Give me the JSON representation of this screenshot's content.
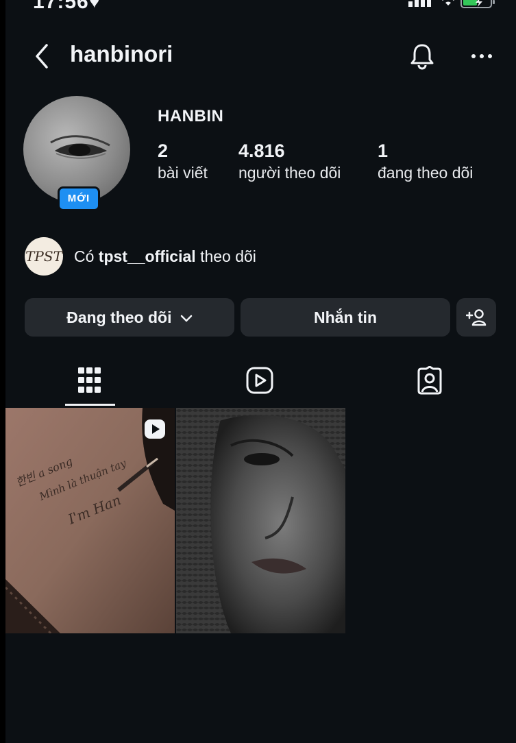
{
  "status_bar": {
    "time": "17:56"
  },
  "header": {
    "username": "hanbinori"
  },
  "profile": {
    "display_name": "HANBIN",
    "new_badge": "MỚI",
    "stats": [
      {
        "value": "2",
        "label": "bài viết"
      },
      {
        "value": "4.816",
        "label": "người theo dõi"
      },
      {
        "value": "1",
        "label": "đang theo dõi"
      }
    ]
  },
  "followed_by": {
    "avatar_text": "TPST",
    "prefix": "Có",
    "account": "tpst__official",
    "suffix": "theo dõi"
  },
  "actions": {
    "following_label": "Đang theo dõi",
    "message_label": "Nhắn tin"
  },
  "tabs": [
    "grid-icon",
    "reels-icon",
    "tagged-icon"
  ],
  "posts": [
    {
      "type": "reel",
      "handwriting": [
        "한빈 a song",
        "Mình là thuận tay",
        "I'm Han"
      ]
    },
    {
      "type": "photo"
    }
  ],
  "colors": {
    "background": "#0c1014",
    "button": "#25292e",
    "accent": "#1e8ff2"
  }
}
